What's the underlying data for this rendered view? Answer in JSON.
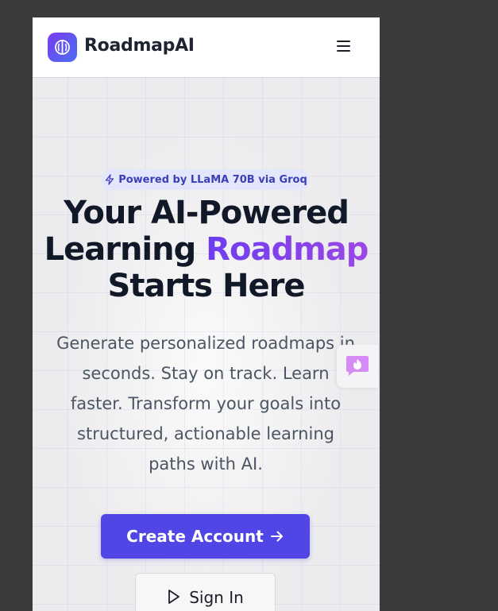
{
  "navbar": {
    "brand": "RoadmapAI",
    "logo_icon": "brain-icon",
    "menu_icon": "hamburger-menu-icon"
  },
  "hero": {
    "badge": {
      "icon": "lightning-icon",
      "text": "Powered by LLaMA 70B via Groq"
    },
    "title": {
      "line1": "Your AI-Powered",
      "line2_prefix": "Learning ",
      "line2_accent": "Roadmap",
      "line3": "Starts Here"
    },
    "description_lines": [
      "Generate personalized roadmaps in",
      "seconds. Stay on track. Learn",
      "faster. Transform your goals into",
      "structured, actionable learning",
      "paths with AI."
    ],
    "primary_button": {
      "label": "Create Account",
      "icon": "arrow-right-icon"
    },
    "secondary_button": {
      "label": "Sign In",
      "icon": "play-icon"
    }
  },
  "floating_widget": {
    "icon": "chat-flame-icon"
  },
  "colors": {
    "brand_primary": "#4f46e5",
    "accent_gradient_start": "#6d3df0",
    "accent_gradient_end": "#9b47e6",
    "badge_bg": "#e4e6fb",
    "badge_text": "#3b3fb8",
    "heading": "#111827",
    "body_text": "#4b5563"
  }
}
